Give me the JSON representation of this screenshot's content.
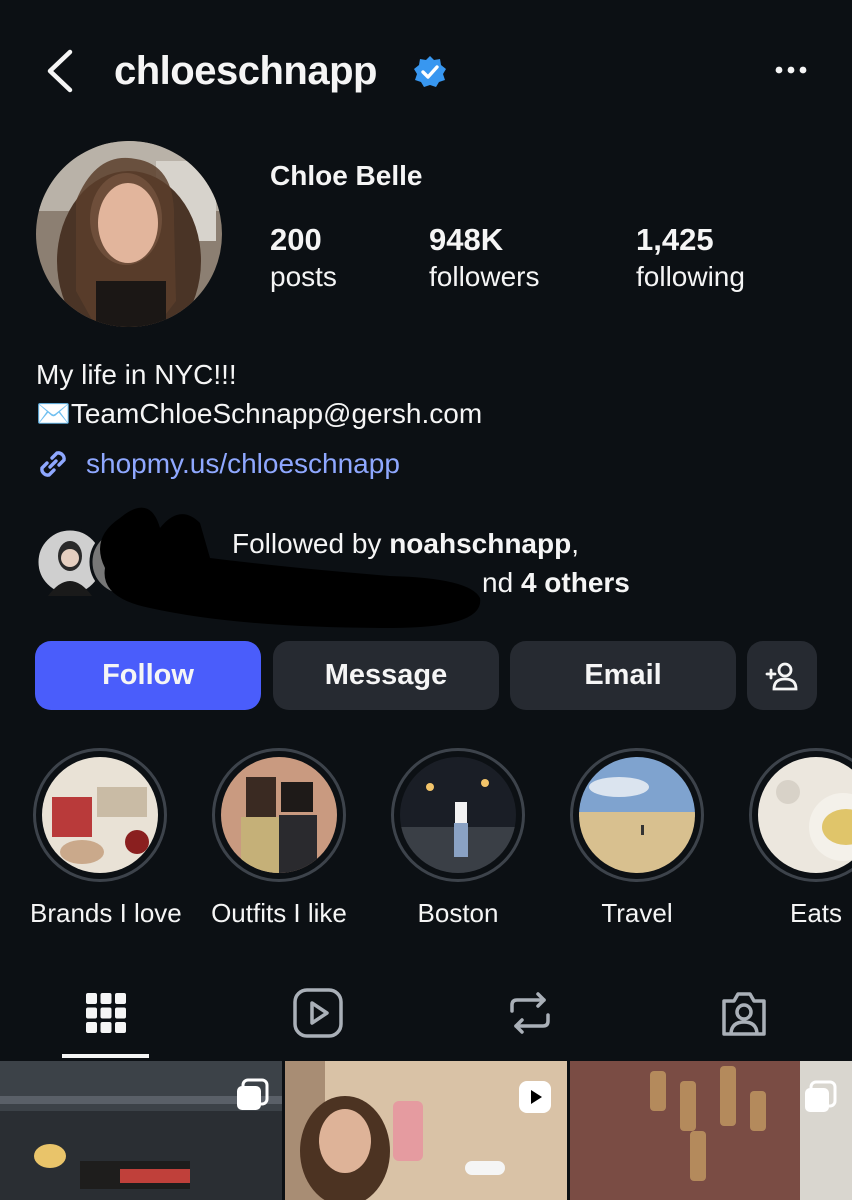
{
  "header": {
    "username": "chloeschnapp",
    "verified": true,
    "back_icon": "chevron-left-icon",
    "more_icon": "more-horizontal-icon"
  },
  "profile": {
    "display_name": "Chloe Belle",
    "stats": [
      {
        "value": "200",
        "label": "posts"
      },
      {
        "value": "948K",
        "label": "followers"
      },
      {
        "value": "1,425",
        "label": "following"
      }
    ],
    "bio_line1": "My life in NYC!!!",
    "bio_line2": "✉️TeamChloeSchnapp@gersh.com",
    "link": "shopmy.us/chloeschnapp",
    "followed_by": {
      "prefix": "Followed by ",
      "user": "noahschnapp",
      "comma": ",",
      "suffix_tail": "nd ",
      "others": "4 others"
    }
  },
  "actions": {
    "follow": "Follow",
    "message": "Message",
    "email": "Email"
  },
  "highlights": [
    {
      "label": "Brands I love"
    },
    {
      "label": "Outfits I like"
    },
    {
      "label": "Boston"
    },
    {
      "label": "Travel"
    },
    {
      "label": "Eats"
    }
  ],
  "tabs": [
    "grid-icon",
    "reels-icon",
    "reposts-icon",
    "tagged-icon"
  ],
  "colors": {
    "background": "#0c1014",
    "follow_button": "#4a5dfb",
    "secondary_button": "#262a31",
    "link": "#8fa8ff",
    "verified": "#3897f0"
  }
}
